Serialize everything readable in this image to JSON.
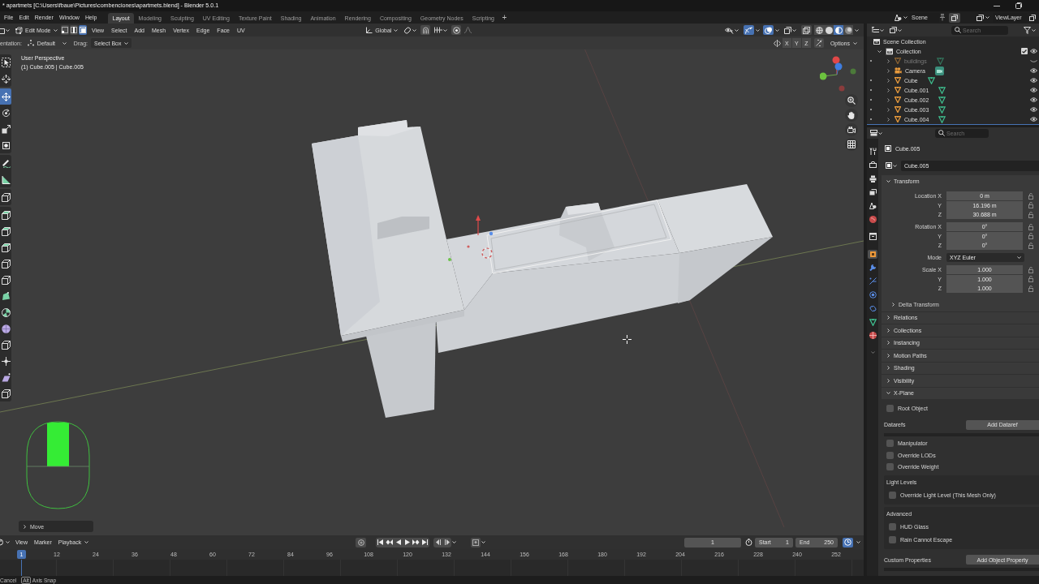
{
  "title_bar": {
    "title": "* apartmets [C:\\Users\\fbaue\\Pictures\\combenciones\\apartmets.blend] - Blender 5.0.1"
  },
  "top_bar": {
    "menus": [
      "File",
      "Edit",
      "Render",
      "Window",
      "Help"
    ],
    "workspaces": [
      {
        "label": "Layout",
        "selected": true
      },
      {
        "label": "Modeling",
        "selected": false
      },
      {
        "label": "Sculpting",
        "selected": false
      },
      {
        "label": "UV Editing",
        "selected": false
      },
      {
        "label": "Texture Paint",
        "selected": false
      },
      {
        "label": "Shading",
        "selected": false
      },
      {
        "label": "Animation",
        "selected": false
      },
      {
        "label": "Rendering",
        "selected": false
      },
      {
        "label": "Compositing",
        "selected": false
      },
      {
        "label": "Geometry Nodes",
        "selected": false
      },
      {
        "label": "Scripting",
        "selected": false
      }
    ],
    "add_workspace": "+",
    "scene": "Scene",
    "view_layer": "ViewLayer"
  },
  "viewport": {
    "header": {
      "mode": "Edit Mode",
      "select_modes": [
        {
          "kind": "vertex",
          "selected": false
        },
        {
          "kind": "edge",
          "selected": false
        },
        {
          "kind": "face",
          "selected": true
        }
      ],
      "menus": [
        "View",
        "Select",
        "Add",
        "Mesh",
        "Vertex",
        "Edge",
        "Face",
        "UV"
      ],
      "orientation": "Global",
      "toggles": [
        {
          "kind": "gizmo",
          "on": true
        },
        {
          "kind": "overlay",
          "on": true
        },
        {
          "kind": "xray",
          "on": false
        }
      ],
      "shading_modes": [
        {
          "kind": "wireframe",
          "selected": false
        },
        {
          "kind": "solid",
          "selected": false
        },
        {
          "kind": "material",
          "selected": true
        },
        {
          "kind": "rendered",
          "selected": false
        }
      ]
    },
    "tool_settings": {
      "orientation_label": "entation:",
      "orientation": "Default",
      "drag_label": "Drag:",
      "drag": "Select Box",
      "mirror_axes": [
        "X",
        "Y",
        "Z"
      ],
      "options": "Options"
    },
    "info": [
      "User Perspective",
      "(1) Cube.005 | Cube.005"
    ],
    "tool_groups": [
      [
        {
          "kind": "select",
          "selected": false
        },
        {
          "kind": "cursor",
          "selected": false
        }
      ],
      [
        {
          "kind": "move",
          "selected": true
        },
        {
          "kind": "rotate",
          "selected": false
        },
        {
          "kind": "scale",
          "selected": false
        },
        {
          "kind": "transform",
          "selected": false
        }
      ],
      [
        {
          "kind": "annotate",
          "selected": false
        },
        {
          "kind": "measure",
          "selected": false
        }
      ],
      [
        {
          "kind": "cube",
          "selected": false
        }
      ],
      [
        {
          "kind": "cube-green",
          "selected": false
        },
        {
          "kind": "cube-green",
          "selected": false
        },
        {
          "kind": "cube-green",
          "selected": false
        },
        {
          "kind": "cube",
          "selected": false
        },
        {
          "kind": "cube",
          "selected": false
        },
        {
          "kind": "polygon",
          "selected": false
        },
        {
          "kind": "spin",
          "selected": false
        },
        {
          "kind": "sphere",
          "selected": false
        },
        {
          "kind": "cube",
          "selected": false
        },
        {
          "kind": "shrink",
          "selected": false
        },
        {
          "kind": "wedge",
          "selected": false
        },
        {
          "kind": "cube",
          "selected": false
        }
      ]
    ],
    "last_operator": "Move"
  },
  "timeline": {
    "menus": [
      "View",
      "Marker"
    ],
    "playback": "Playback",
    "current_frame": "1",
    "start_label": "Start",
    "start": "1",
    "end_label": "End",
    "end": "250",
    "playhead": "1",
    "ruler": [
      "12",
      "24",
      "36",
      "48",
      "60",
      "72",
      "84",
      "96",
      "108",
      "120",
      "132",
      "144",
      "156",
      "168",
      "180",
      "192",
      "204",
      "216",
      "228",
      "240",
      "252"
    ]
  },
  "outliner": {
    "search_placeholder": "Search",
    "root": "Scene Collection",
    "collections": [
      {
        "name": "Collection",
        "expanded": true,
        "checked": true,
        "visible": true,
        "children": [
          {
            "name": "buildings",
            "kind": "mesh",
            "expanded": false,
            "visible": false
          },
          {
            "name": "Camera",
            "kind": "camera",
            "expanded": false,
            "visible": true
          },
          {
            "name": "Cube",
            "kind": "mesh",
            "expanded": false,
            "visible": true
          },
          {
            "name": "Cube.001",
            "kind": "mesh",
            "expanded": false,
            "visible": true
          },
          {
            "name": "Cube.002",
            "kind": "mesh",
            "expanded": false,
            "visible": true
          },
          {
            "name": "Cube.003",
            "kind": "mesh",
            "expanded": false,
            "visible": true
          },
          {
            "name": "Cube.004",
            "kind": "mesh",
            "expanded": false,
            "visible": true
          }
        ]
      }
    ]
  },
  "properties": {
    "search_placeholder": "Search",
    "tabs": [
      {
        "kind": "tool",
        "selected": false
      },
      {
        "kind": "render",
        "selected": false
      },
      {
        "kind": "output",
        "selected": false
      },
      {
        "kind": "view_layer",
        "selected": false
      },
      {
        "kind": "scene",
        "selected": false
      },
      {
        "kind": "world",
        "selected": false
      },
      {
        "kind": "collection",
        "selected": false
      },
      {
        "kind": "object",
        "selected": true
      },
      {
        "kind": "modifiers",
        "selected": false
      },
      {
        "kind": "particles",
        "selected": false
      },
      {
        "kind": "physics",
        "selected": false
      },
      {
        "kind": "constraints",
        "selected": false
      },
      {
        "kind": "data",
        "selected": false
      },
      {
        "kind": "material",
        "selected": false
      }
    ],
    "context": "Cube.005",
    "name": "Cube.005",
    "panels": [
      {
        "kind": "transform",
        "title": "Transform",
        "expanded": true,
        "groups": [
          [
            {
              "kind": "number",
              "label": "Location X",
              "value": "0 m"
            },
            {
              "kind": "number",
              "label": "Y",
              "value": "16.196 m"
            },
            {
              "kind": "number",
              "label": "Z",
              "value": "30.688 m"
            }
          ],
          [
            {
              "kind": "number",
              "label": "Rotation X",
              "value": "0°"
            },
            {
              "kind": "number",
              "label": "Y",
              "value": "0°"
            },
            {
              "kind": "number",
              "label": "Z",
              "value": "0°"
            }
          ],
          [
            {
              "kind": "dropdown",
              "label": "Mode",
              "value": "XYZ Euler"
            }
          ],
          [
            {
              "kind": "number",
              "label": "Scale X",
              "value": "1.000"
            },
            {
              "kind": "number",
              "label": "Y",
              "value": "1.000"
            },
            {
              "kind": "number",
              "label": "Z",
              "value": "1.000"
            }
          ]
        ],
        "subpanels": [
          {
            "title": "Delta Transform",
            "expanded": false
          }
        ]
      },
      {
        "title": "Relations",
        "expanded": false
      },
      {
        "title": "Collections",
        "expanded": false
      },
      {
        "title": "Instancing",
        "expanded": false
      },
      {
        "title": "Motion Paths",
        "expanded": false
      },
      {
        "title": "Shading",
        "expanded": false
      },
      {
        "title": "Visibility",
        "expanded": false
      },
      {
        "kind": "xplane",
        "title": "X-Plane",
        "expanded": true,
        "items": [
          {
            "kind": "checkbox",
            "label": "Root Object",
            "checked": false
          },
          {
            "kind": "button_row",
            "label": "Datarefs",
            "button": "Add Dataref"
          },
          {
            "kind": "checkbox",
            "label": "Manipulator",
            "checked": false
          },
          {
            "kind": "checkbox",
            "label": "Override LODs",
            "checked": false
          },
          {
            "kind": "checkbox",
            "label": "Override Weight",
            "checked": false
          },
          {
            "kind": "box",
            "title": "Light Levels",
            "items": [
              {
                "kind": "checkbox",
                "label": "Override Light Level (This Mesh Only)",
                "checked": false
              }
            ]
          },
          {
            "kind": "box",
            "title": "Advanced",
            "items": [
              {
                "kind": "checkbox",
                "label": "HUD Glass",
                "checked": false
              },
              {
                "kind": "checkbox",
                "label": "Rain Cannot Escape",
                "checked": false
              }
            ]
          },
          {
            "kind": "button_row",
            "label": "Custom Properties",
            "button": "Add Object Property"
          }
        ]
      }
    ]
  },
  "status_bar": {
    "items": [
      {
        "kind": "text",
        "label": "Cancel"
      },
      {
        "kind": "key",
        "label": "Alt"
      },
      {
        "kind": "text",
        "label": "Axis Snap"
      }
    ]
  }
}
